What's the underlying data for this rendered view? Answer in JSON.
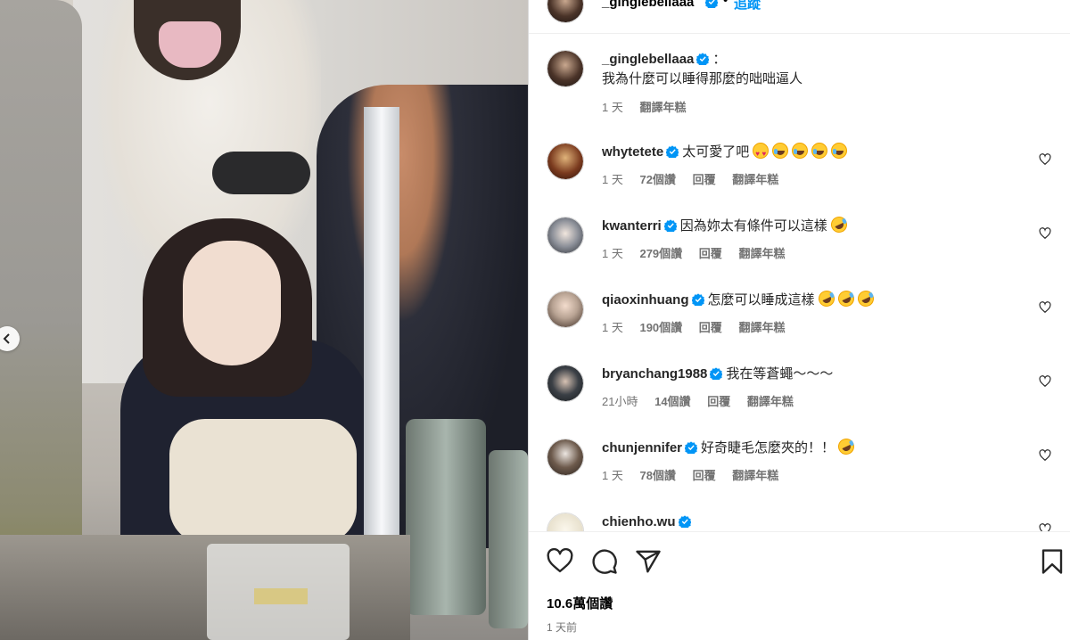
{
  "header": {
    "username": "_ginglebellaaa",
    "separator": "•",
    "follow_label": "追蹤"
  },
  "caption": {
    "username": "_ginglebellaaa",
    "colon": "：",
    "text": "我為什麼可以睡得那麼的咄咄逼人",
    "time": "1 天",
    "translate": "翻譯年糕"
  },
  "comments": [
    {
      "username": "whytetete",
      "text": "太可愛了吧",
      "emojis": [
        "heart-eyes",
        "joy",
        "joy",
        "joy",
        "joy"
      ],
      "time": "1 天",
      "likes": "72個讚",
      "reply": "回覆",
      "translate": "翻譯年糕",
      "avatar_color": "#7a3a1e"
    },
    {
      "username": "kwanterri",
      "text": "因為妳太有條件可以這樣",
      "emojis": [
        "rofl"
      ],
      "time": "1 天",
      "likes": "279個讚",
      "reply": "回覆",
      "translate": "翻譯年糕",
      "avatar_color": "#8b8f98"
    },
    {
      "username": "qiaoxinhuang",
      "text": "怎麼可以睡成這樣",
      "emojis": [
        "rofl",
        "rofl",
        "rofl"
      ],
      "time": "1 天",
      "likes": "190個讚",
      "reply": "回覆",
      "translate": "翻譯年糕",
      "avatar_color": "#b8a393"
    },
    {
      "username": "bryanchang1988",
      "text": "我在等蒼蠅～～～",
      "emojis": [],
      "time": "21小時",
      "likes": "14個讚",
      "reply": "回覆",
      "translate": "翻譯年糕",
      "avatar_color": "#3b4046"
    },
    {
      "username": "chunjennifer",
      "text": "好奇睫毛怎麼夾的！！",
      "emojis": [
        "rofl"
      ],
      "time": "1 天",
      "likes": "78個讚",
      "reply": "回覆",
      "translate": "翻譯年糕",
      "avatar_color": "#6d5a4c"
    },
    {
      "username": "chienho.wu",
      "text": "",
      "emojis": [],
      "time": "",
      "likes": "",
      "reply": "",
      "translate": "",
      "avatar_color": "#e9e2cf"
    }
  ],
  "footer": {
    "likes": "10.6萬個讚",
    "posted": "1 天前"
  },
  "icons": [
    "chevron-left-icon",
    "verified-badge-icon",
    "heart-icon",
    "comment-icon",
    "share-icon",
    "bookmark-icon"
  ],
  "colors": {
    "verified": "#0095f6",
    "follow": "#0095f6",
    "muted": "#737373"
  }
}
